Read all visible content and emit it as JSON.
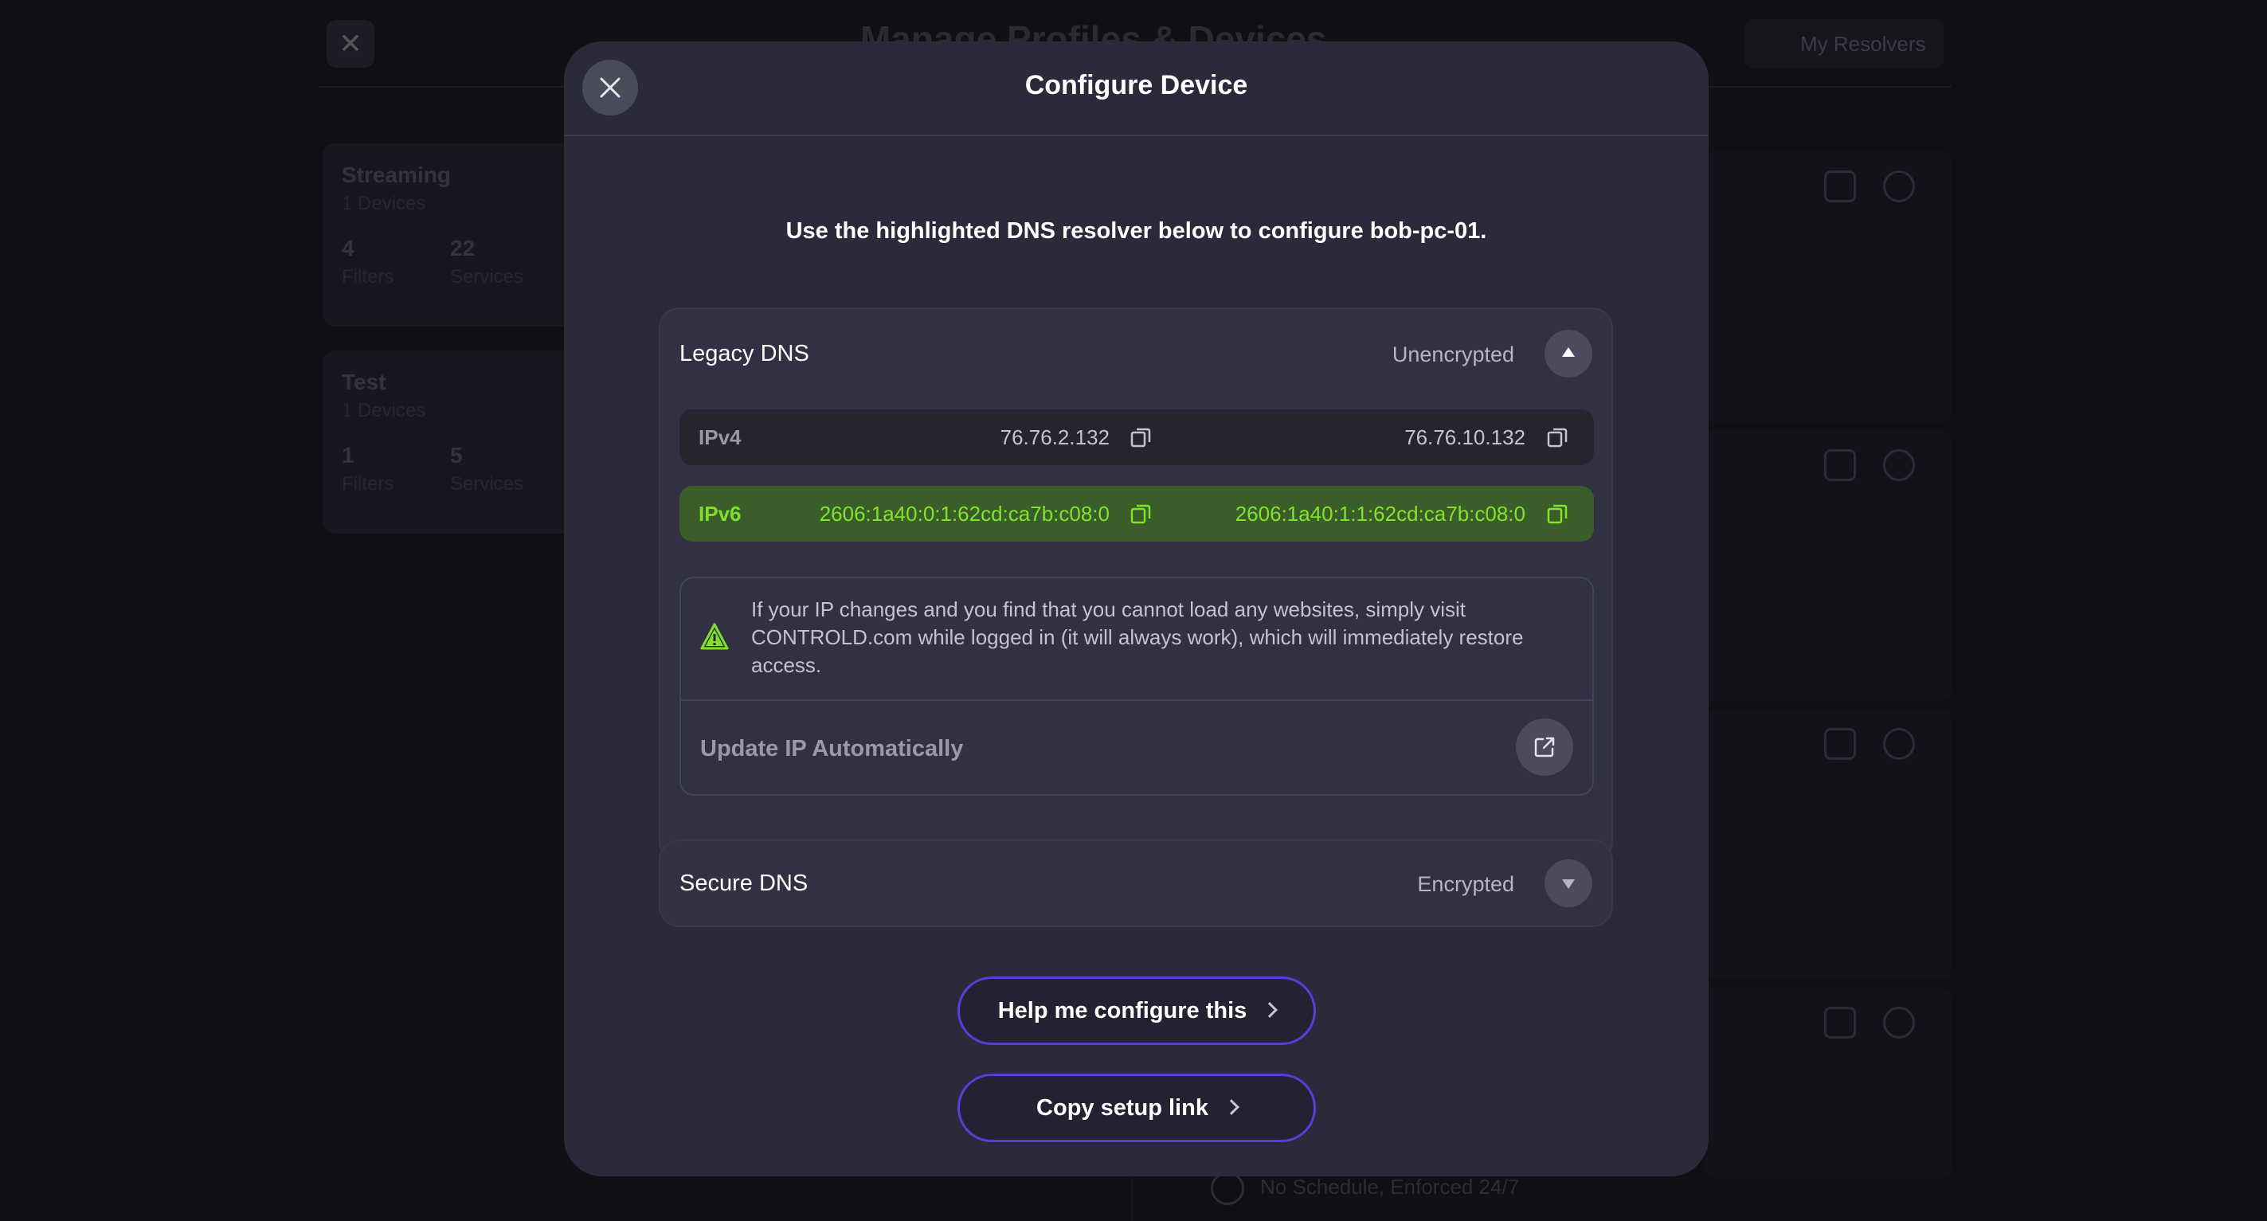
{
  "background": {
    "title": "Manage Profiles & Devices",
    "my_resolvers": "My Resolvers",
    "profiles": [
      {
        "name": "Streaming",
        "devices": "1 Devices",
        "filters_count": "4",
        "filters_label": "Filters",
        "services_count": "22",
        "services_label": "Services"
      },
      {
        "name": "Test",
        "devices": "1 Devices",
        "filters_count": "1",
        "filters_label": "Filters",
        "services_count": "5",
        "services_label": "Services"
      }
    ],
    "schedule": "No Schedule, Enforced 24/7"
  },
  "modal": {
    "title": "Configure Device",
    "instruction": "Use the highlighted DNS resolver below to configure bob-pc-01.",
    "legacy": {
      "title": "Legacy DNS",
      "status": "Unencrypted",
      "expanded": true,
      "ipv4": {
        "label": "IPv4",
        "primary": "76.76.2.132",
        "secondary": "76.76.10.132"
      },
      "ipv6": {
        "label": "IPv6",
        "primary": "2606:1a40:0:1:62cd:ca7b:c08:0",
        "secondary": "2606:1a40:1:1:62cd:ca7b:c08:0",
        "highlighted": true
      },
      "notice": "If your IP changes and you find that you cannot load any websites, simply visit CONTROLD.com while logged in (it will always work), which will immediately restore access.",
      "update_ip_label": "Update IP Automatically"
    },
    "secure": {
      "title": "Secure DNS",
      "status": "Encrypted",
      "expanded": false
    },
    "help_button": "Help me configure this",
    "copy_button": "Copy setup link"
  },
  "colors": {
    "modal_bg": "#2a2a3b",
    "highlight_bg": "#3b5d2a",
    "highlight_text": "#7ee02a",
    "button_border": "#5a3cd6",
    "warning_icon": "#7ee02a"
  },
  "icons": [
    "close-icon",
    "copy-icon",
    "warning-icon",
    "external-link-icon",
    "chevron-up-icon",
    "chevron-down-icon",
    "chevron-right-icon"
  ]
}
